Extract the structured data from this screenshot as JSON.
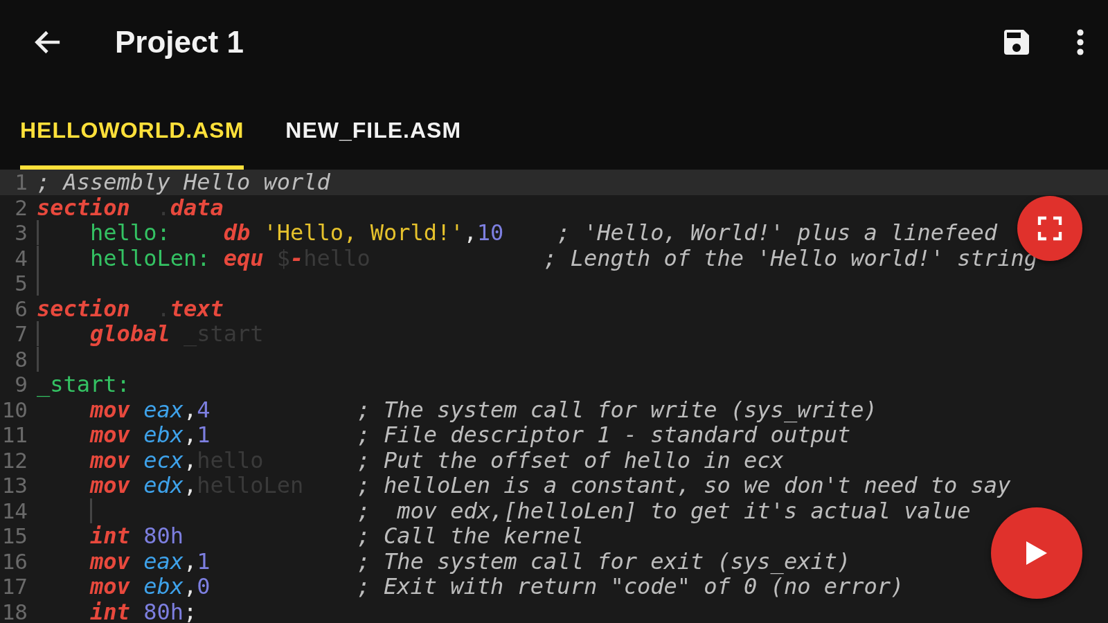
{
  "app_bar": {
    "title": "Project 1"
  },
  "tabs": [
    {
      "label": "HELLOWORLD.ASM",
      "selected": true
    },
    {
      "label": "NEW_FILE.ASM",
      "selected": false
    }
  ],
  "editor": {
    "lines": [
      {
        "number": "1",
        "current": true,
        "tokens": [
          {
            "kind": "comment",
            "text": "; Assembly Hello world"
          }
        ]
      },
      {
        "number": "2",
        "current": false,
        "tokens": [
          {
            "kind": "keyword",
            "text": "section"
          },
          {
            "kind": "dim",
            "text": "  ."
          },
          {
            "kind": "keyword",
            "text": "data"
          }
        ]
      },
      {
        "number": "3",
        "current": false,
        "tokens": [
          {
            "kind": "guide"
          },
          {
            "kind": "label",
            "text": "   hello:"
          },
          {
            "kind": "keyword",
            "text": "    db"
          },
          {
            "kind": "string",
            "text": " 'Hello, World!'"
          },
          {
            "kind": "punct",
            "text": ","
          },
          {
            "kind": "number",
            "text": "10"
          },
          {
            "kind": "comment",
            "text": "    ; 'Hello, World!' plus a linefeed"
          }
        ]
      },
      {
        "number": "4",
        "current": false,
        "tokens": [
          {
            "kind": "guide"
          },
          {
            "kind": "label",
            "text": "   helloLen:"
          },
          {
            "kind": "keyword",
            "text": " equ"
          },
          {
            "kind": "dim",
            "text": " $"
          },
          {
            "kind": "keyword",
            "text": "-"
          },
          {
            "kind": "dim",
            "text": "hello"
          },
          {
            "kind": "comment",
            "text": "             ; Length of the 'Hello world!' string"
          }
        ]
      },
      {
        "number": "5",
        "current": false,
        "tokens": [
          {
            "kind": "guide"
          }
        ]
      },
      {
        "number": "6",
        "current": false,
        "tokens": [
          {
            "kind": "keyword",
            "text": "section"
          },
          {
            "kind": "dim",
            "text": "  ."
          },
          {
            "kind": "keyword",
            "text": "text"
          }
        ]
      },
      {
        "number": "7",
        "current": false,
        "tokens": [
          {
            "kind": "guide"
          },
          {
            "kind": "keyword",
            "text": "   global"
          },
          {
            "kind": "dim",
            "text": " _start"
          }
        ]
      },
      {
        "number": "8",
        "current": false,
        "tokens": [
          {
            "kind": "guide"
          }
        ]
      },
      {
        "number": "9",
        "current": false,
        "tokens": [
          {
            "kind": "label",
            "text": "_start:"
          }
        ]
      },
      {
        "number": "10",
        "current": false,
        "tokens": [
          {
            "kind": "keyword",
            "text": "    mov"
          },
          {
            "kind": "register",
            "text": " eax"
          },
          {
            "kind": "punct",
            "text": ","
          },
          {
            "kind": "number",
            "text": "4"
          },
          {
            "kind": "comment",
            "text": "           ; The system call for write (sys_write)"
          }
        ]
      },
      {
        "number": "11",
        "current": false,
        "tokens": [
          {
            "kind": "keyword",
            "text": "    mov"
          },
          {
            "kind": "register",
            "text": " ebx"
          },
          {
            "kind": "punct",
            "text": ","
          },
          {
            "kind": "number",
            "text": "1"
          },
          {
            "kind": "comment",
            "text": "           ; File descriptor 1 - standard output"
          }
        ]
      },
      {
        "number": "12",
        "current": false,
        "tokens": [
          {
            "kind": "keyword",
            "text": "    mov"
          },
          {
            "kind": "register",
            "text": " ecx"
          },
          {
            "kind": "punct",
            "text": ","
          },
          {
            "kind": "dim",
            "text": "hello"
          },
          {
            "kind": "comment",
            "text": "       ; Put the offset of hello in ecx"
          }
        ]
      },
      {
        "number": "13",
        "current": false,
        "tokens": [
          {
            "kind": "keyword",
            "text": "    mov"
          },
          {
            "kind": "register",
            "text": " edx"
          },
          {
            "kind": "punct",
            "text": ","
          },
          {
            "kind": "dim",
            "text": "helloLen"
          },
          {
            "kind": "comment",
            "text": "    ; helloLen is a constant, so we don't need to say"
          }
        ]
      },
      {
        "number": "14",
        "current": false,
        "tokens": [
          {
            "kind": "indent-guide"
          },
          {
            "kind": "comment",
            "text": "                   ;  mov edx,[helloLen] to get it's actual value"
          }
        ]
      },
      {
        "number": "15",
        "current": false,
        "tokens": [
          {
            "kind": "keyword",
            "text": "    int"
          },
          {
            "kind": "number",
            "text": " 80h"
          },
          {
            "kind": "comment",
            "text": "             ; Call the kernel"
          }
        ]
      },
      {
        "number": "16",
        "current": false,
        "tokens": [
          {
            "kind": "keyword",
            "text": "    mov"
          },
          {
            "kind": "register",
            "text": " eax"
          },
          {
            "kind": "punct",
            "text": ","
          },
          {
            "kind": "number",
            "text": "1"
          },
          {
            "kind": "comment",
            "text": "           ; The system call for exit (sys_exit)"
          }
        ]
      },
      {
        "number": "17",
        "current": false,
        "tokens": [
          {
            "kind": "keyword",
            "text": "    mov"
          },
          {
            "kind": "register",
            "text": " ebx"
          },
          {
            "kind": "punct",
            "text": ","
          },
          {
            "kind": "number",
            "text": "0"
          },
          {
            "kind": "comment",
            "text": "           ; Exit with return \"code\" of 0 (no error)"
          }
        ]
      },
      {
        "number": "18",
        "current": false,
        "tokens": [
          {
            "kind": "keyword",
            "text": "    int"
          },
          {
            "kind": "number",
            "text": " 80h"
          },
          {
            "kind": "punct",
            "text": ";"
          }
        ]
      }
    ]
  }
}
